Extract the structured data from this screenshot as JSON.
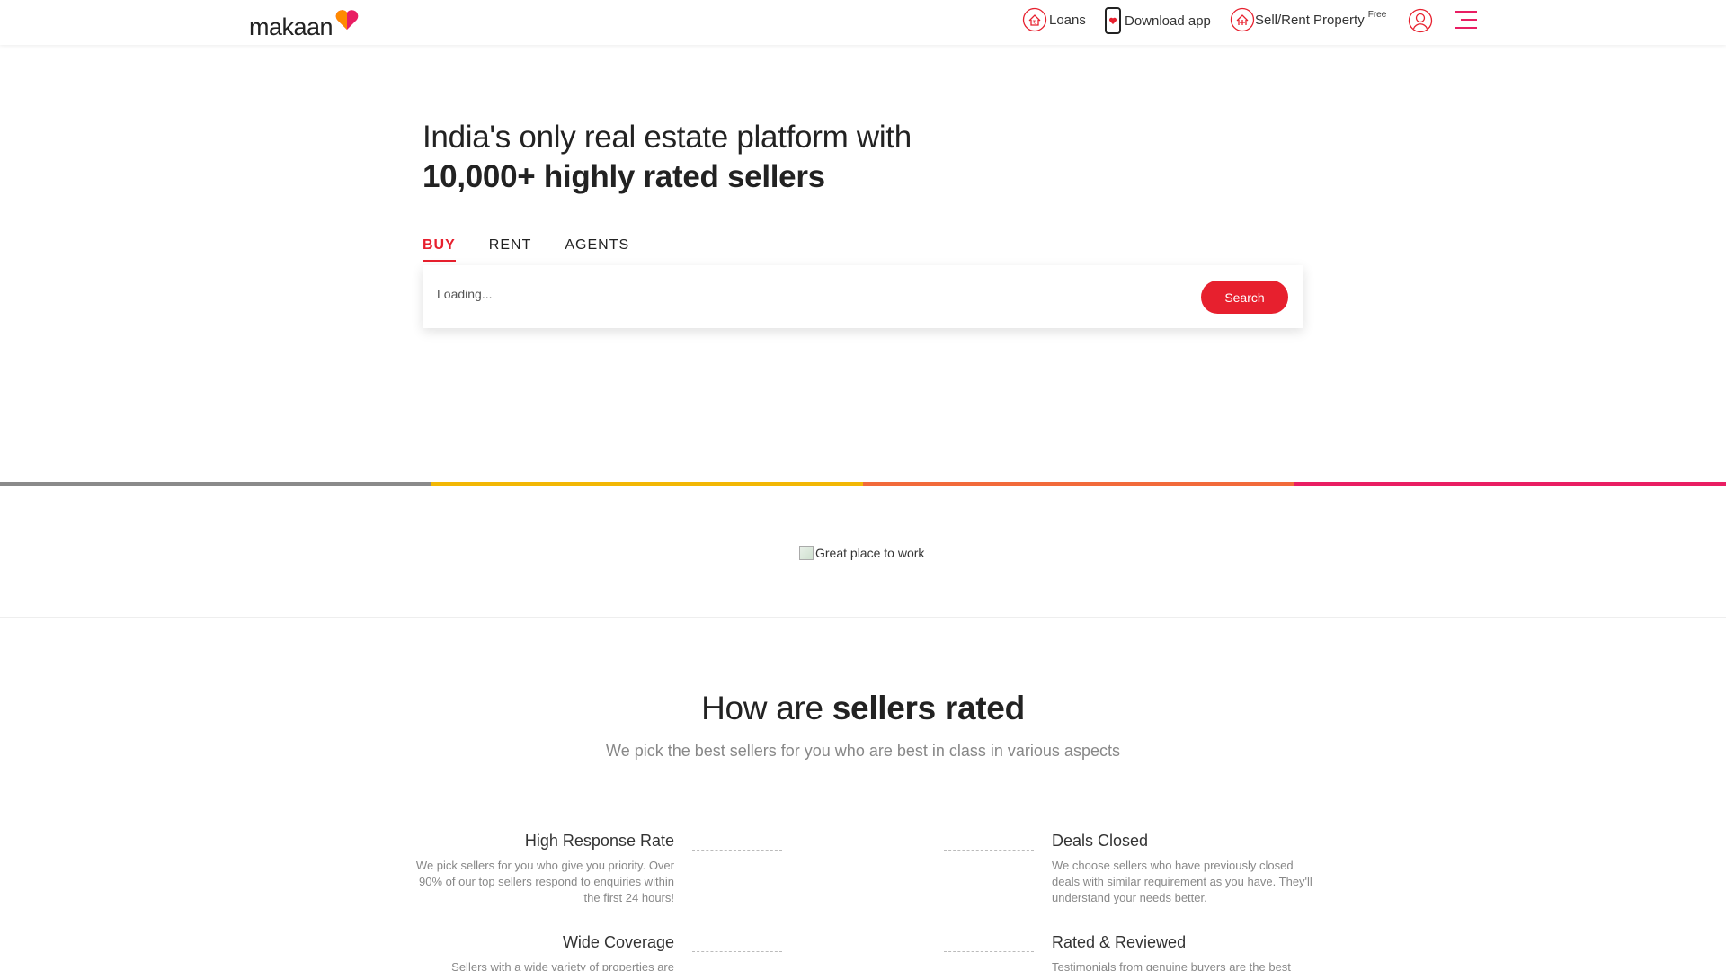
{
  "header": {
    "logo_text": "makaan",
    "nav": {
      "loans": "Loans",
      "download_app": "Download app",
      "sell_rent": "Sell/Rent Property",
      "sell_rent_badge": "Free"
    }
  },
  "hero": {
    "line1": "India's only real estate platform with",
    "line2": "10,000+ highly rated sellers",
    "tabs": [
      "BUY",
      "RENT",
      "AGENTS"
    ],
    "active_tab": "BUY",
    "search_placeholder": "Loading...",
    "search_button": "Search"
  },
  "stripe_colors": [
    "#8a8a8a",
    "#f2b705",
    "#f26a3a",
    "#e91e63"
  ],
  "badge_alt": "Great place to work",
  "rated": {
    "title_normal": "How are",
    "title_bold": "sellers rated",
    "subtitle": "We pick the best sellers for you who are best in class in various aspects",
    "features": [
      {
        "title": "High Response Rate",
        "text": "We pick sellers for you who give you priority. Over 90% of our top sellers respond to enquiries within the first 24 hours!"
      },
      {
        "title": "Deals Closed",
        "text": "We choose sellers who have previously closed deals with similar requirement as you have. They'll understand your needs better."
      },
      {
        "title": "Wide Coverage",
        "text": "Sellers with a wide variety of properties are"
      },
      {
        "title": "Rated & Reviewed",
        "text": "Testimonials from genuine buyers are the best"
      }
    ]
  },
  "colors": {
    "accent": "#e7202e",
    "heart_orange": "#ff8a00",
    "heart_pink": "#e91e63"
  }
}
